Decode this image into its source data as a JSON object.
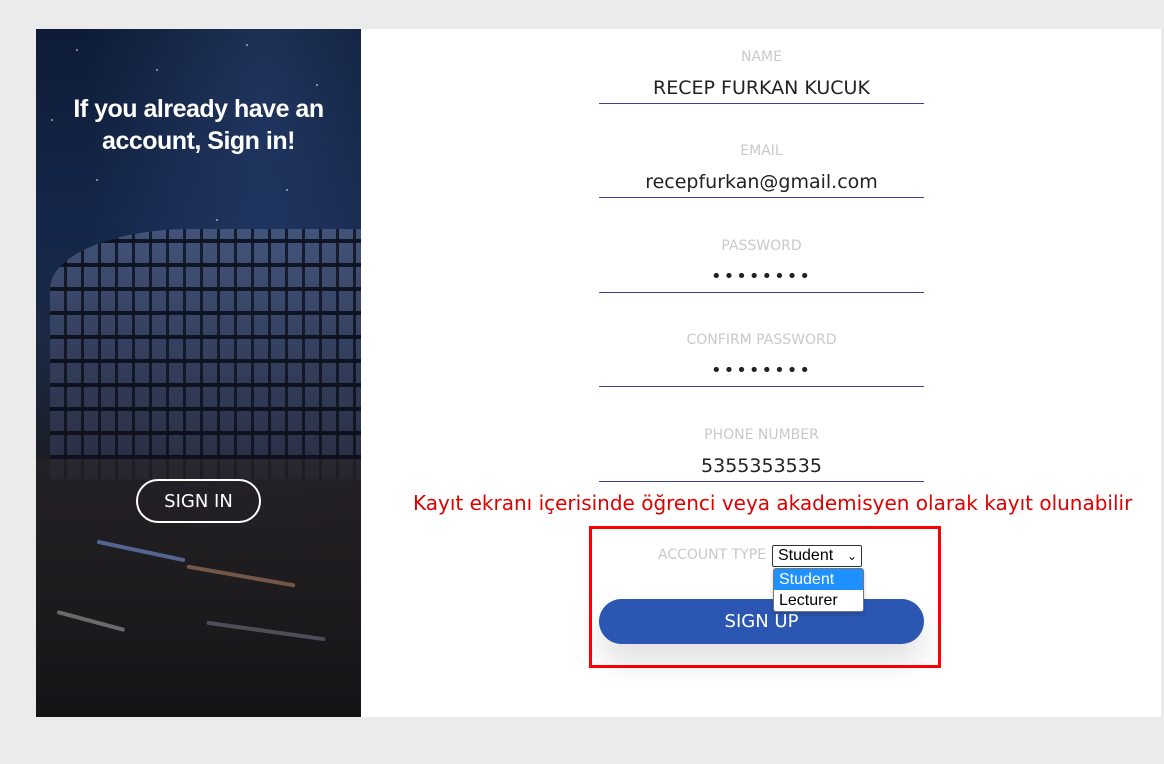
{
  "side": {
    "title": "If you already have an account, Sign in!",
    "signin_label": "SIGN IN"
  },
  "form": {
    "name": {
      "label": "NAME",
      "value": "RECEP FURKAN KUCUK"
    },
    "email": {
      "label": "EMAIL",
      "value": "recepfurkan@gmail.com"
    },
    "password": {
      "label": "PASSWORD",
      "value": "••••••••"
    },
    "confirm_password": {
      "label": "CONFIRM PASSWORD",
      "value": "••••••••"
    },
    "phone": {
      "label": "PHONE NUMBER",
      "value": "5355353535"
    },
    "account_type": {
      "label": "ACCOUNT TYPE",
      "selected": "Student",
      "options": [
        "Student",
        "Lecturer"
      ]
    },
    "signup_label": "SIGN UP"
  },
  "annotation": "Kayıt ekranı içerisinde öğrenci veya akademisyen olarak kayıt olunabilir",
  "colors": {
    "page_bg": "#ebebeb",
    "button_blue": "#2b57b3",
    "annotation_red": "#ff0000",
    "dropdown_highlight": "#1e90ff",
    "label_gray": "#c9c9c9"
  }
}
